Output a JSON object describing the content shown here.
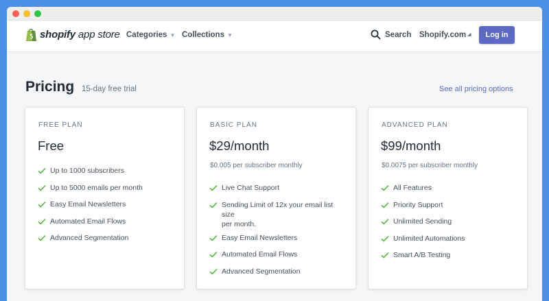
{
  "window": {
    "dots": [
      "#ff5f57",
      "#febc2e",
      "#28c840"
    ]
  },
  "header": {
    "logo_bold": "shopify",
    "logo_light": " app store",
    "nav": [
      {
        "label": "Categories"
      },
      {
        "label": "Collections"
      }
    ],
    "search_label": "Search",
    "shopify_com": "Shopify.com",
    "login_label": "Log in"
  },
  "pricing": {
    "title": "Pricing",
    "subtitle": "15-day free trial",
    "see_all": "See all pricing options"
  },
  "plans": [
    {
      "label": "FREE PLAN",
      "price": "Free",
      "note": "",
      "features": [
        [
          "Up to 1000 subscribers"
        ],
        [
          "Up to 5000 emails per month"
        ],
        [
          "Easy Email Newsletters"
        ],
        [
          "Automated Email Flows"
        ],
        [
          "Advanced Segmentation"
        ]
      ]
    },
    {
      "label": "BASIC PLAN",
      "price": "$29/month",
      "note": "$0.005 per subscriber monthly",
      "features": [
        [
          "Live Chat Support"
        ],
        [
          "Sending Limit of 12x your email list size",
          "per month."
        ],
        [
          "Easy Email Newsletters"
        ],
        [
          "Automated Email Flows"
        ],
        [
          "Advanced Segmentation"
        ]
      ]
    },
    {
      "label": "ADVANCED PLAN",
      "price": "$99/month",
      "note": "$0.0075 per subscriber monthly",
      "features": [
        [
          "All Features"
        ],
        [
          "Priority Support"
        ],
        [
          "Unlimited Sending"
        ],
        [
          "Unlimited Automations"
        ],
        [
          "Smart A/B Testing"
        ]
      ]
    }
  ],
  "colors": {
    "accent": "#5c6ac4",
    "check": "#50b83c",
    "logo_green": "#95bf47"
  },
  "icons": {
    "search": "magnifier-icon",
    "check": "checkmark-icon",
    "external": "external-link-icon"
  }
}
